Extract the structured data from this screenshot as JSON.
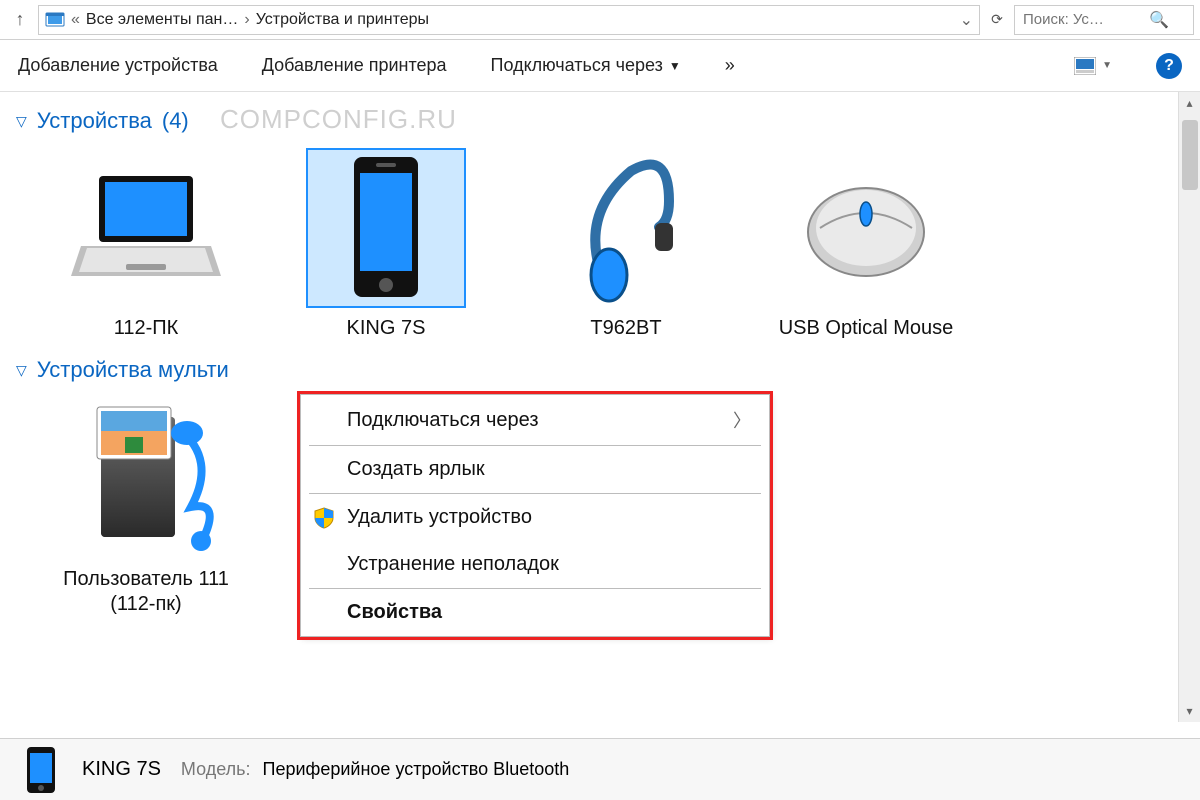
{
  "address": {
    "up_title": "Вверх",
    "crumb1": "Все элементы пан…",
    "crumb2": "Устройства и принтеры",
    "search_placeholder": "Поиск: Ус…"
  },
  "toolbar": {
    "add_device": "Добавление устройства",
    "add_printer": "Добавление принтера",
    "connect_via": "Подключаться через",
    "more": "»"
  },
  "groups": {
    "devices": {
      "label": "Устройства",
      "count": "(4)"
    },
    "multimedia": {
      "label": "Устройства мульти"
    }
  },
  "watermark": "COMPCONFIG.RU",
  "devices": {
    "pc": {
      "label": "112-ПК"
    },
    "phone": {
      "label": "KING 7S"
    },
    "headset": {
      "label": "T962BT"
    },
    "mouse": {
      "label": "USB Optical Mouse"
    }
  },
  "multimedia": {
    "mediacenter": {
      "label": "Пользователь 111 (112-пк)"
    }
  },
  "contextmenu": {
    "connect_via": "Подключаться через",
    "create_shortcut": "Создать ярлык",
    "remove_device": "Удалить устройство",
    "troubleshoot": "Устранение неполадок",
    "properties": "Свойства"
  },
  "details": {
    "name": "KING 7S",
    "model_key": "Модель:",
    "model_val": "Периферийное устройство Bluetooth"
  }
}
